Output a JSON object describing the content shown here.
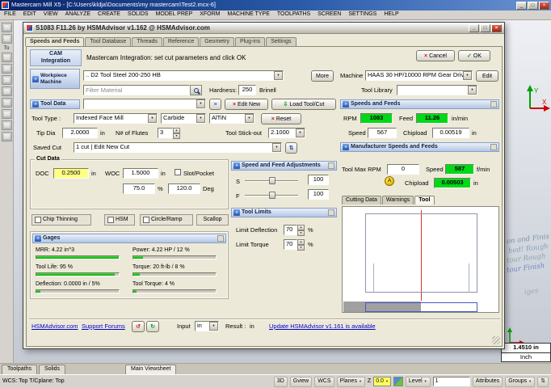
{
  "icons": {
    "minimize": "_",
    "maximize": "□",
    "close": "×",
    "dropdown": "▼",
    "up": "▲",
    "down": "▼",
    "cancel": "×",
    "ok": "✓",
    "load": "⇩",
    "sync": "⇅",
    "list": "≡",
    "chevrons": "»",
    "undo": "↺",
    "redo": "↻"
  },
  "window": {
    "title": "Mastercam Mill X5 - [C:\\Users\\kldja\\Documents\\my mastercam\\Test2.mcx-6]",
    "menus": [
      "FILE",
      "EDIT",
      "VIEW",
      "ANALYZE",
      "CREATE",
      "SOLIDS",
      "MODEL PREP",
      "XFORM",
      "MACHINE TYPE",
      "TOOLPATHS",
      "SCREEN",
      "SETTINGS",
      "HELP"
    ],
    "side_panel_label": "To"
  },
  "dialog": {
    "title": "S1083 F11.26 by HSMAdvisor v1.162 @ HSMAdvisor.com",
    "tabs": [
      "Speeds and Feeds",
      "Tool Database",
      "Threads",
      "Reference",
      "Geometry",
      "Plug-ins",
      "Settings"
    ],
    "cam": {
      "label1": "CAM",
      "label2": "Integration",
      "message": "Mastercam Integration: set cut parameters and click OK",
      "cancel": "Cancel",
      "ok": "OK"
    },
    "workpiece": {
      "label1": "Workpiece",
      "label2": "Machine",
      "material": ".. D2 Tool Steel 200-250 HB",
      "more": "More",
      "machine_label": "Machine",
      "machine": "HAAS 30 HP/10000 RPM Gear Drive",
      "edit": "Edit",
      "filter_placeholder": "Filter Material",
      "hardness_label": "Hardness:",
      "hardness": "250",
      "hardness_unit": "Brinell",
      "tool_library_label": "Tool Library"
    },
    "tool": {
      "section": "Tool Data",
      "edit_new": "Edit New",
      "load": "Load Tool/Cut",
      "type_label": "Tool Type :",
      "type": "Indexed Face Mill",
      "material": "Carbide",
      "coating": "AlTiN",
      "reset": "Reset",
      "tip_dia_label": "Tip Dia",
      "tip_dia": "2.0000",
      "tip_dia_unit": "in",
      "flutes_label": "N# of Flutes",
      "flutes": "3",
      "stickout_label": "Tool Stick-out",
      "stickout": "2.1000",
      "saved_cut_label": "Saved Cut",
      "saved_cut": "1 cut | Edit New Cut"
    },
    "speeds": {
      "section": "Speeds and Feeds",
      "rpm_label": "RPM",
      "rpm": "1083",
      "feed_label": "Feed",
      "feed": "11.26",
      "feed_unit": "in/min",
      "speed_label": "Speed",
      "speed": "567",
      "chipload_label": "Chipload",
      "chipload": "0.00519",
      "chipload_unit": "in"
    },
    "mfr": {
      "section": "Manufacturer Speeds and Feeds",
      "max_rpm_label": "Tool Max RPM",
      "max_rpm": "0",
      "speed_label": "Speed",
      "speed": "587",
      "speed_unit": "f/min",
      "led": "A",
      "chipload_label": "Chipload",
      "chipload": "0.00503",
      "chipload_unit": "in",
      "tabs": [
        "Cutting Data",
        "Warnings",
        "Tool"
      ]
    },
    "cut": {
      "section": "Cut Data",
      "doc_label": "DOC",
      "doc": "0.2500",
      "doc_unit": "in",
      "woc_label": "WOC",
      "woc": "1.5000",
      "woc_unit": "in",
      "slot": "Slot/Pocket",
      "stepover": "75.0",
      "stepover_unit": "%",
      "angle": "120.0",
      "angle_unit": "Deg",
      "chip_thinning": "Chip Thinning",
      "hsm": "HSM",
      "circle_ramp": "Circle/Ramp",
      "scallop": "Scallop"
    },
    "adjust": {
      "section": "Speed and Feed Adjustments",
      "s_label": "S",
      "s_value": "100",
      "f_label": "F",
      "f_value": "100"
    },
    "limits": {
      "section": "Tool Limits",
      "deflection_label": "Limit Deflection",
      "deflection": "70",
      "torque_label": "Limit Torque",
      "torque": "70",
      "unit_pct": "%"
    },
    "gages": {
      "section": "Gages",
      "mrr": "MRR: 4.22 in^3",
      "power": "Power: 4.22 HP / 12 %",
      "tool_life": "Tool Life: 95 %",
      "torque": "Torque: 20 ft-lb / 8 %",
      "deflection": "Deflection: 0.0000 in / 5%",
      "tool_torque": "Tool Torque: 4 %",
      "bars": {
        "mrr": 100,
        "power": 12,
        "tool_life": 95,
        "torque": 8,
        "deflection": 5,
        "tool_torque": 4
      }
    },
    "footer": {
      "site": "HSMAdvisor.com",
      "forums": "Support Forums",
      "input_label": "Input",
      "input_unit": "in",
      "result_label": "Result :",
      "result_unit": "in",
      "update": "Update HSMAdvisor v1.161 is available"
    }
  },
  "graphics": {
    "notes": [
      "on and Finis",
      "hed! Rough",
      "tour Rough",
      "tour Finish",
      "iges"
    ],
    "axis_x": "X",
    "axis_y": "Y",
    "measure_value": "1.4510 in",
    "measure_unit": "Inch"
  },
  "bottom": {
    "tab_toolpaths": "Toolpaths",
    "tab_solids": "Solids",
    "viewsheet": "Main Viewsheet",
    "status_left": "WCS: Top  T/Cplane: Top",
    "btn_3d": "3D",
    "btn_gview": "Gview",
    "btn_wcs": "WCS",
    "btn_planes": "Planes",
    "z_label": "Z",
    "z_value": "0.0",
    "btn_level": "Level",
    "level_value": "1",
    "btn_attributes": "Attributes",
    "btn_groups": "Groups"
  }
}
